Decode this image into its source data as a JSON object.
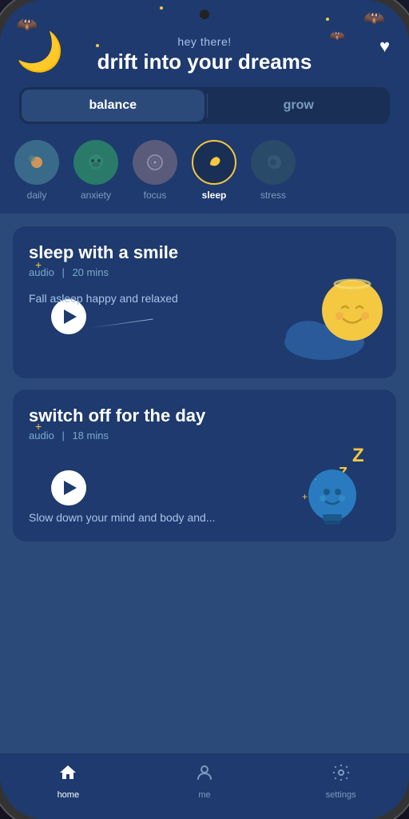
{
  "header": {
    "greeting": "hey there!",
    "tagline": "drift into your dreams",
    "heart_label": "♥"
  },
  "toggle": {
    "option1": "balance",
    "option2": "grow",
    "active": "balance"
  },
  "categories": [
    {
      "id": "daily",
      "label": "daily",
      "active": false,
      "icon": "sun",
      "color": "cat-daily"
    },
    {
      "id": "anxiety",
      "label": "anxiety",
      "active": false,
      "icon": "face",
      "color": "cat-anxiety"
    },
    {
      "id": "focus",
      "label": "focus",
      "active": false,
      "icon": "circle",
      "color": "cat-focus"
    },
    {
      "id": "sleep",
      "label": "sleep",
      "active": true,
      "icon": "moon",
      "color": "cat-sleep"
    },
    {
      "id": "stress",
      "label": "stress",
      "active": false,
      "icon": "wave",
      "color": "cat-stress"
    }
  ],
  "cards": [
    {
      "id": "card1",
      "title": "sleep with a smile",
      "type": "audio",
      "duration": "20 mins",
      "description": "Fall asleep happy\nand relaxed"
    },
    {
      "id": "card2",
      "title": "switch off for the day",
      "type": "audio",
      "duration": "18 mins",
      "description": "Slow down your\nmind and body and..."
    }
  ],
  "nav": {
    "items": [
      {
        "id": "home",
        "label": "home",
        "icon": "home",
        "active": true
      },
      {
        "id": "me",
        "label": "me",
        "icon": "person",
        "active": false
      },
      {
        "id": "settings",
        "label": "settings",
        "icon": "gear",
        "active": false
      }
    ]
  }
}
